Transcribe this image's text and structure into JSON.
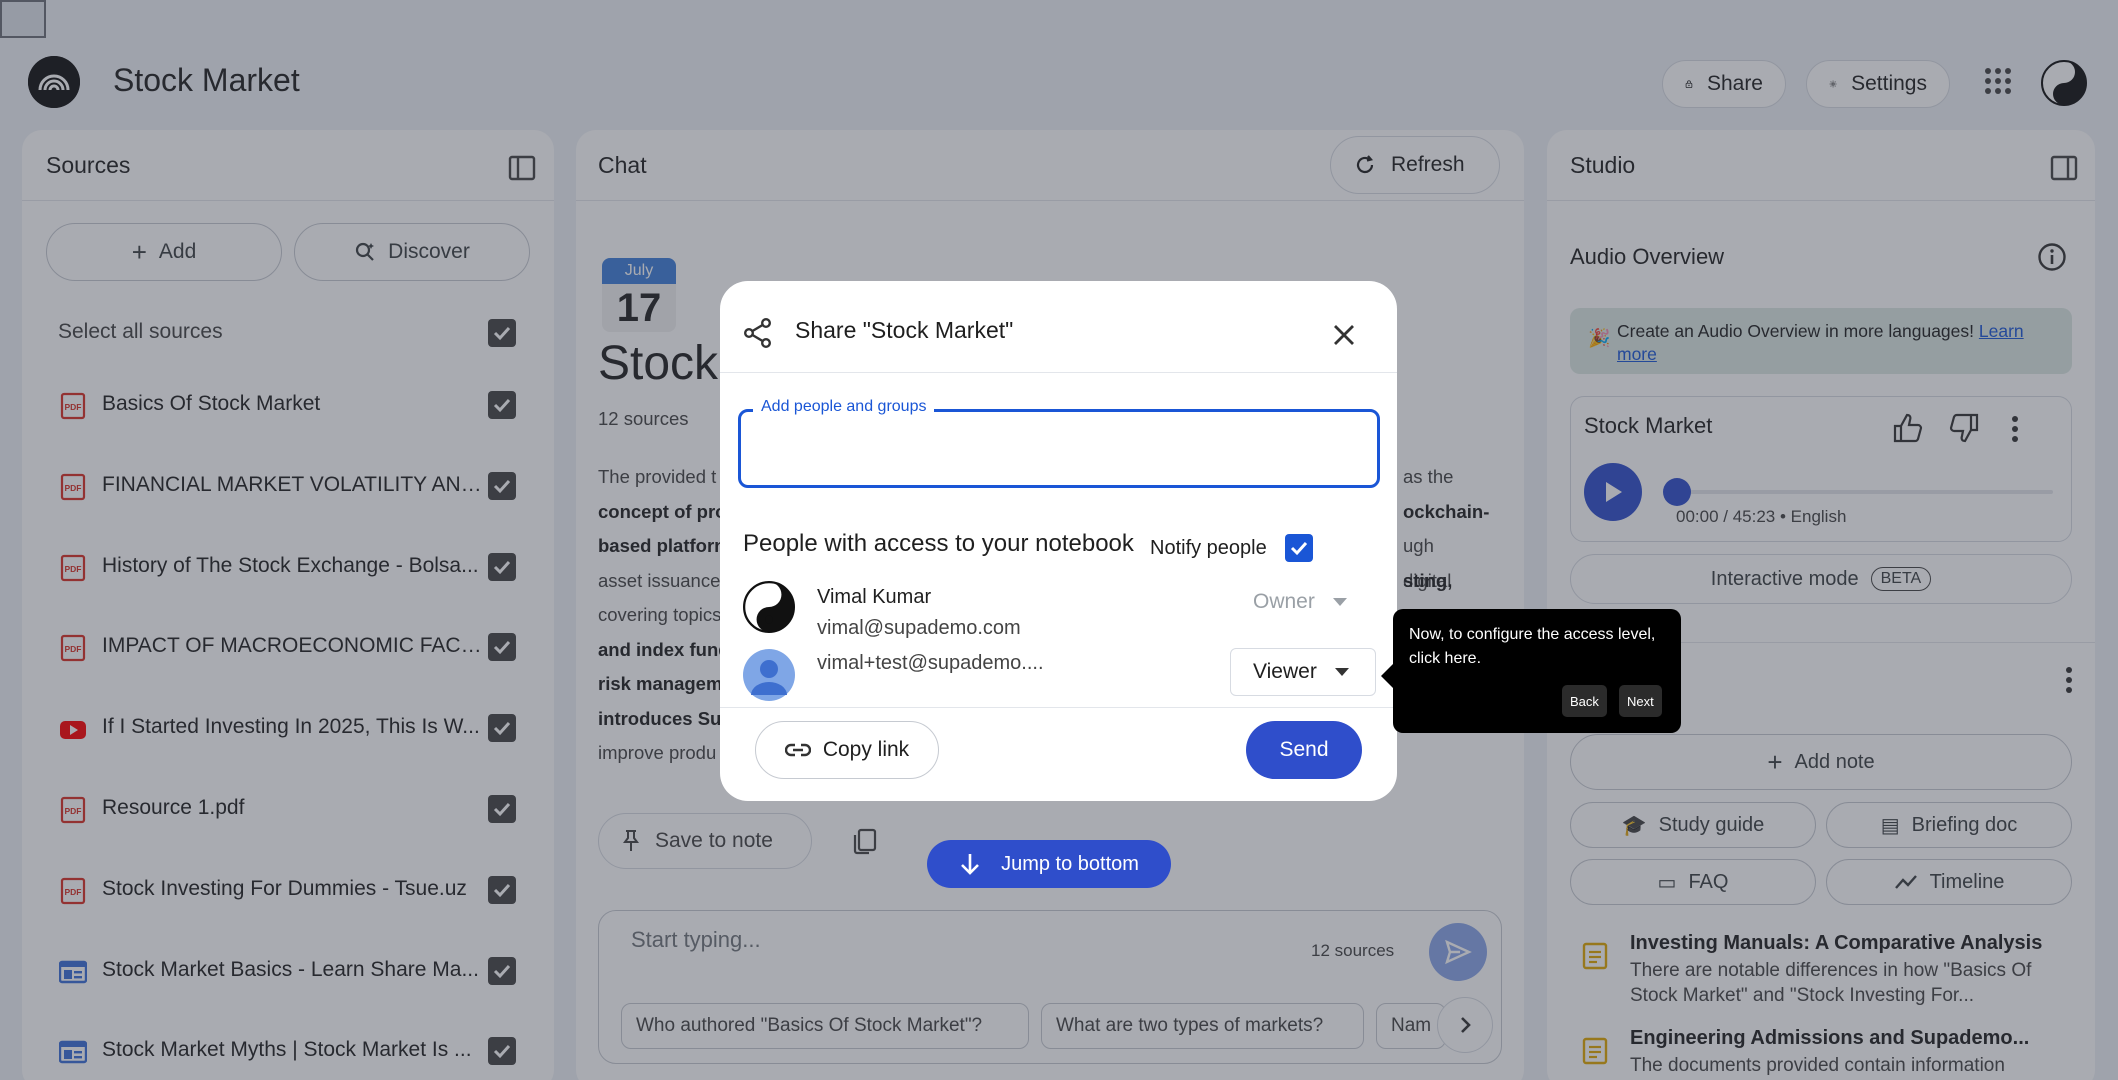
{
  "header": {
    "app_title": "Stock Market",
    "share_label": "Share",
    "settings_label": "Settings"
  },
  "sources": {
    "title": "Sources",
    "add_label": "Add",
    "discover_label": "Discover",
    "select_all_label": "Select all sources",
    "items": [
      {
        "label": "Basics Of Stock Market",
        "icon": "pdf-icon"
      },
      {
        "label": "FINANCIAL MARKET VOLATILITY AND I...",
        "icon": "pdf-icon"
      },
      {
        "label": "History of The Stock Exchange - Bolsa...",
        "icon": "pdf-icon"
      },
      {
        "label": "IMPACT OF MACROECONOMIC FACTO...",
        "icon": "pdf-icon"
      },
      {
        "label": "If I Started Investing In 2025, This Is W...",
        "icon": "youtube-icon"
      },
      {
        "label": "Resource 1.pdf",
        "icon": "pdf-icon"
      },
      {
        "label": "Stock Investing For Dummies - Tsue.uz",
        "icon": "pdf-icon"
      },
      {
        "label": "Stock Market Basics - Learn Share Ma...",
        "icon": "web-icon"
      },
      {
        "label": "Stock Market Myths | Stock Market Is ...",
        "icon": "web-icon"
      }
    ]
  },
  "chat": {
    "title": "Chat",
    "refresh_label": "Refresh",
    "calendar_month": "July",
    "calendar_day": "17",
    "notebook_title": "Stock",
    "sources_count": "12 sources",
    "summary_lines": [
      [
        "The provided t",
        "",
        "as the"
      ],
      [
        "concept of pro",
        "",
        "ockchain-"
      ],
      [
        "based platforn",
        "",
        "ugh digital"
      ],
      [
        "asset issuance",
        "",
        "sting,"
      ],
      [
        "covering topics",
        "",
        ""
      ],
      [
        "and index fund",
        "",
        ""
      ],
      [
        "risk managem",
        "",
        ""
      ],
      [
        "introduces Sup",
        "",
        ""
      ],
      [
        "improve produ",
        "",
        ""
      ]
    ],
    "save_to_note_label": "Save to note",
    "jump_label": "Jump to bottom",
    "input_placeholder": "Start typing...",
    "input_sources_count": "12 sources",
    "suggestions": [
      "Who authored \"Basics Of Stock Market\"?",
      "What are two types of markets?",
      "Nam"
    ]
  },
  "studio": {
    "title": "Studio",
    "audio_overview_title": "Audio Overview",
    "banner_text": "Create an Audio Overview in more languages!",
    "banner_link": "Learn more",
    "audio_card_title": "Stock Market",
    "audio_time": "00:00 / 45:23 • English",
    "audio_progress": 0,
    "interactive_mode_label": "Interactive mode",
    "beta_label": "BETA",
    "add_note_label": "Add note",
    "study_guide_label": "Study guide",
    "briefing_doc_label": "Briefing doc",
    "faq_label": "FAQ",
    "timeline_label": "Timeline",
    "notes": [
      {
        "title": "Investing Manuals: A Comparative Analysis",
        "body": "There are notable differences in how \"Basics Of Stock Market\" and \"Stock Investing For..."
      },
      {
        "title": "Engineering Admissions and Supademo...",
        "body": "The documents provided contain information"
      }
    ]
  },
  "share_dialog": {
    "title": "Share \"Stock Market\"",
    "field_label": "Add people and groups",
    "field_value": "",
    "people_title": "People with access to your notebook",
    "notify_label": "Notify people",
    "notify_checked": true,
    "people": [
      {
        "name": "Vimal Kumar",
        "email": "vimal@supademo.com",
        "role": "Owner"
      },
      {
        "name": "",
        "email": "vimal+test@supademo....",
        "role": "Viewer"
      }
    ],
    "copy_link_label": "Copy link",
    "send_label": "Send"
  },
  "tooltip": {
    "text": "Now, to configure the access level, click here.",
    "back_label": "Back",
    "next_label": "Next"
  },
  "colors": {
    "accent": "#1a56d6",
    "send_button": "#2f4ecb",
    "overlay": "#323846",
    "pdf_red": "#d93025",
    "youtube_red": "#ff0000",
    "web_blue": "#3b6fd8"
  }
}
